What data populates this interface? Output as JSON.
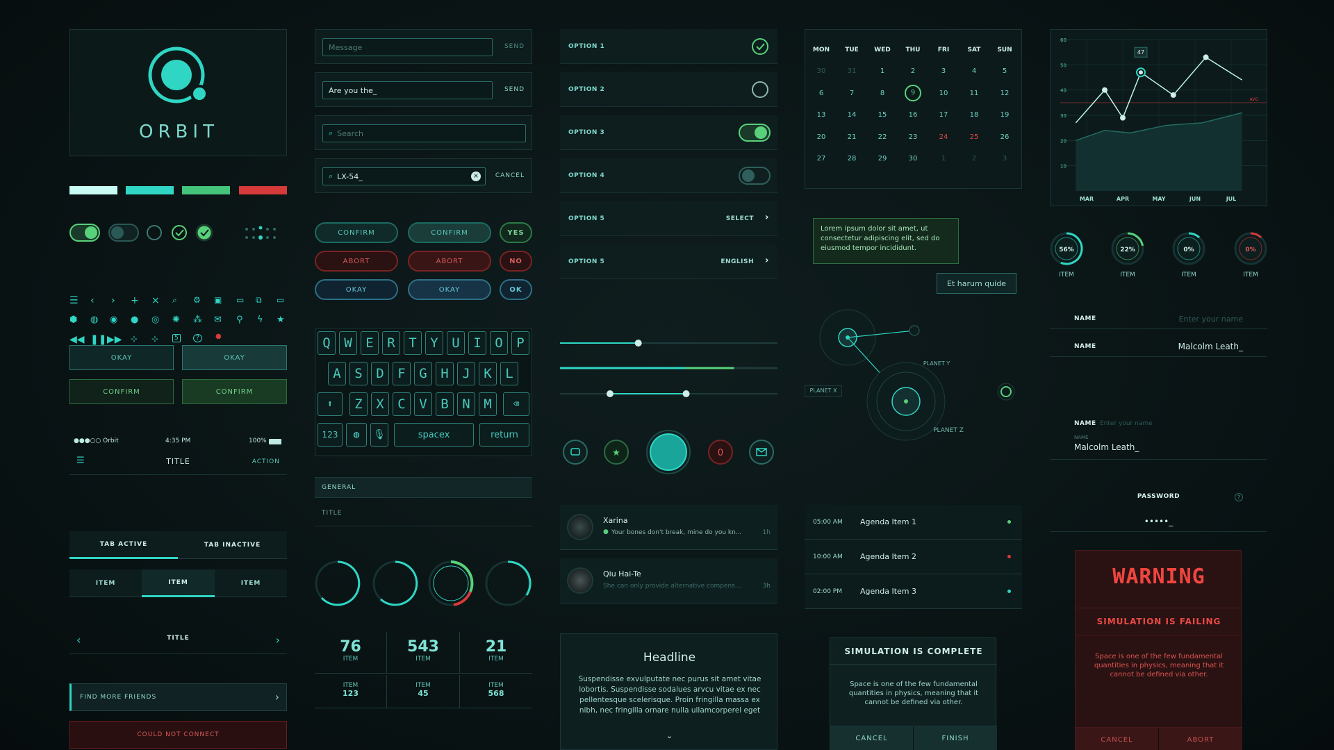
{
  "brand": {
    "name": "ORBIT"
  },
  "colors": {
    "accent": "#2fd6c4",
    "green": "#58d17a",
    "red": "#d43a3a",
    "swatches": [
      "#c8fbf4",
      "#2fd6c4",
      "#44c47a",
      "#d63a3a"
    ]
  },
  "buttons": {
    "okay": "OKAY",
    "confirm": "CONFIRM"
  },
  "status_bar": {
    "carrier": "●●●○○ Orbit",
    "time": "4:35 PM",
    "battery": "100%"
  },
  "nav": {
    "title": "TITLE",
    "action": "ACTION"
  },
  "tabs": {
    "active": "TAB ACTIVE",
    "inactive": "TAB INACTIVE"
  },
  "segmented": [
    "ITEM",
    "ITEM",
    "ITEM"
  ],
  "pager": {
    "title": "TITLE"
  },
  "find_friends": "FIND MORE FRIENDS",
  "error": "COULD NOT CONNECT",
  "messages": [
    {
      "value": "",
      "placeholder": "Message",
      "action": "SEND"
    },
    {
      "value": "Are you the_",
      "placeholder": "",
      "action": "SEND"
    }
  ],
  "search": {
    "placeholder": "Search"
  },
  "search_active": {
    "value": "LX-54_",
    "action": "CANCEL"
  },
  "pill_buttons": {
    "confirm": "CONFIRM",
    "yes": "YES",
    "abort": "ABORT",
    "no": "NO",
    "okay": "OKAY",
    "ok": "OK"
  },
  "keyboard": {
    "row1": [
      "Q",
      "W",
      "E",
      "R",
      "T",
      "Y",
      "U",
      "I",
      "O",
      "P"
    ],
    "row2": [
      "A",
      "S",
      "D",
      "F",
      "G",
      "H",
      "J",
      "K",
      "L"
    ],
    "row3": [
      "Z",
      "X",
      "C",
      "V",
      "B",
      "N",
      "M"
    ],
    "numbers": "123",
    "space": "spacex",
    "return": "return"
  },
  "list_section": {
    "header": "GENERAL",
    "item": "TITLE"
  },
  "stats": [
    {
      "value": "76",
      "label": "ITEM"
    },
    {
      "value": "543",
      "label": "ITEM"
    },
    {
      "value": "21",
      "label": "ITEM"
    }
  ],
  "stats_small": [
    {
      "label": "ITEM",
      "value": "123"
    },
    {
      "label": "ITEM",
      "value": "45"
    },
    {
      "label": "ITEM",
      "value": "568"
    }
  ],
  "options": [
    {
      "label": "OPTION 1",
      "control": "check"
    },
    {
      "label": "OPTION 2",
      "control": "radio"
    },
    {
      "label": "OPTION 3",
      "control": "toggle-on"
    },
    {
      "label": "OPTION 4",
      "control": "toggle-off"
    },
    {
      "label": "OPTION 5",
      "value": "SELECT"
    },
    {
      "label": "OPTION 5",
      "value": "ENGLISH"
    }
  ],
  "sliders": [
    {
      "value": 0.36
    },
    {
      "value": 0.8
    },
    {
      "low": 0.23,
      "high": 0.58
    }
  ],
  "action_bar": {
    "badge": "0"
  },
  "chats": [
    {
      "name": "Xarina",
      "preview": "Your bones don't break, mine do you kn...",
      "time": "1h"
    },
    {
      "name": "Qiu Hai-Te",
      "preview": "She can only provide alternative compens...",
      "time": "3h"
    }
  ],
  "article": {
    "headline": "Headline",
    "body": "Suspendisse exvulputate nec purus sit amet vitae lobortis. Suspendisse sodalues arvcu vitae ex nec pellentesque scelerisque. Proin fringilla massa ex nibh, nec fringilla ornare nulla ullamcorperel eget"
  },
  "calendar": {
    "days": [
      "MON",
      "TUE",
      "WED",
      "THU",
      "FRI",
      "SAT",
      "SUN"
    ],
    "weeks": [
      [
        "30",
        "31",
        "1",
        "2",
        "3",
        "4",
        "5"
      ],
      [
        "6",
        "7",
        "8",
        "9",
        "10",
        "11",
        "12"
      ],
      [
        "13",
        "14",
        "15",
        "16",
        "17",
        "18",
        "19"
      ],
      [
        "20",
        "21",
        "22",
        "23",
        "24",
        "25",
        "26"
      ],
      [
        "27",
        "28",
        "29",
        "30",
        "1",
        "2",
        "3"
      ]
    ],
    "selected": "9",
    "red": [
      "24",
      "25"
    ]
  },
  "tooltip": "Lorem ipsum dolor sit amet, ut consectetur adipiscing elit, sed do eiusmod tempor incididunt.",
  "tag": "Et harum quide",
  "orbital": {
    "planet_x": "PLANET X",
    "planet_y": "PLANET Y",
    "planet_z": "PLANET Z"
  },
  "agenda": [
    {
      "time": "05:00 AM",
      "title": "Agenda Item 1",
      "status": "#58d17a"
    },
    {
      "time": "10:00 AM",
      "title": "Agenda Item 2",
      "status": "#d43a3a"
    },
    {
      "time": "02:00 PM",
      "title": "Agenda Item 3",
      "status": "#2fd6c4"
    }
  ],
  "sim_complete": {
    "title": "SIMULATION IS COMPLETE",
    "body": "Space is one of the few fundamental quantities in physics, meaning that it cannot be defined via other.",
    "cancel": "CANCEL",
    "finish": "FINISH"
  },
  "chart_data": {
    "type": "line",
    "x": [
      "MAR",
      "APR",
      "MAY",
      "JUN",
      "JUL"
    ],
    "y_ticks": [
      "60",
      "50",
      "40",
      "30",
      "20",
      "10"
    ],
    "ylim": [
      0,
      60
    ],
    "series": [
      {
        "values": [
          [
            -0.3,
            27
          ],
          [
            0.5,
            40
          ],
          [
            1,
            29
          ],
          [
            1.5,
            47
          ],
          [
            2.4,
            38
          ],
          [
            3.3,
            53
          ],
          [
            4.3,
            44
          ]
        ]
      },
      {
        "values": [
          [
            -0.3,
            20
          ],
          [
            0.5,
            24
          ],
          [
            1.2,
            23
          ],
          [
            2.2,
            26
          ],
          [
            3.2,
            27
          ],
          [
            4.3,
            31
          ]
        ]
      }
    ],
    "highlight": {
      "label": "47"
    },
    "reference_line": {
      "label": "AVG",
      "value": 35
    }
  },
  "gauges": [
    {
      "value": "56%",
      "label": "ITEM",
      "fraction": 0.56,
      "color": "#2fd6c4"
    },
    {
      "value": "22%",
      "label": "ITEM",
      "fraction": 0.22,
      "color": "#58d17a"
    },
    {
      "value": "0%",
      "label": "ITEM",
      "fraction": 0.0,
      "color": "#2fd6c4"
    },
    {
      "value": "0%",
      "label": "ITEM",
      "fraction": 0.0,
      "color": "#d43a3a"
    }
  ],
  "form": {
    "name_label": "NAME",
    "name_placeholder": "Enter your name",
    "name_value": "Malcolm Leath_",
    "name_small": "NAME",
    "password_label": "PASSWORD",
    "password_value": "•••••_",
    "help": "?"
  },
  "warning": {
    "headline": "WARNING",
    "title": "SIMULATION IS FAILING",
    "body": "Space is one of the few fundamental quantities in physics, meaning that it cannot be defined via other.",
    "cancel": "CANCEL",
    "abort": "ABORT"
  }
}
